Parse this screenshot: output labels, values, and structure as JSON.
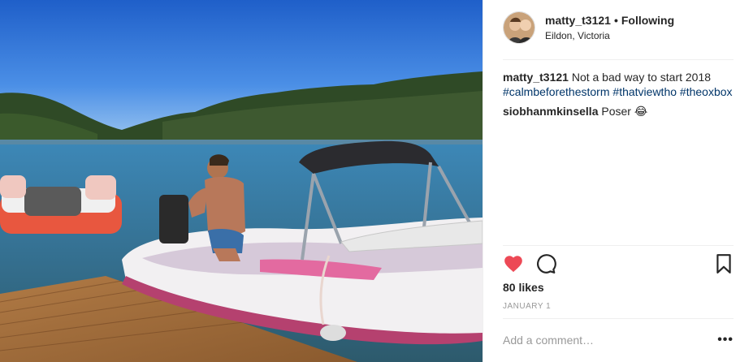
{
  "post": {
    "username": "matty_t3121",
    "separator": "•",
    "follow_state": "Following",
    "location": "Eildon, Victoria",
    "avatar_icon": "user-avatar-photo",
    "image_icon": "photo-boat-on-lake"
  },
  "caption": {
    "user": "matty_t3121",
    "text": " Not a bad way to start 2018 ",
    "hashtags": [
      "#calmbeforethestorm",
      "#thatviewtho",
      "#theoxbox"
    ]
  },
  "comments": [
    {
      "user": "siobhanmkinsella",
      "text": " Poser ",
      "emoji": "😂"
    }
  ],
  "actions": {
    "like_icon": "heart-icon",
    "comment_icon": "comment-bubble-icon",
    "save_icon": "bookmark-icon",
    "like_color": "#ed4956"
  },
  "likes": "80 likes",
  "date": "JANUARY 1",
  "add_comment": {
    "placeholder": "Add a comment…",
    "more_label": "•••"
  }
}
